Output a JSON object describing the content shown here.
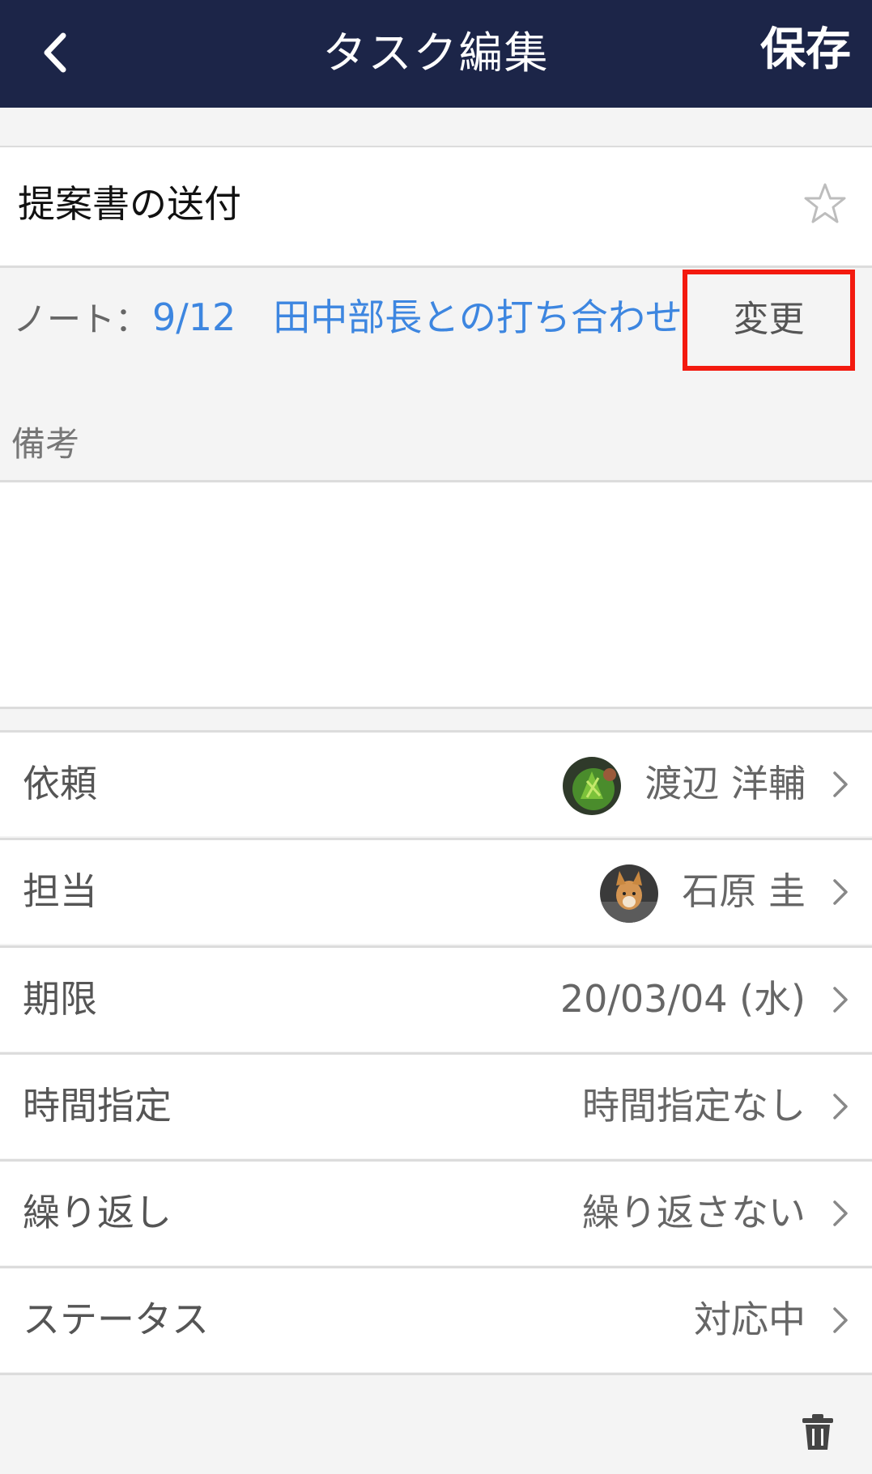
{
  "header": {
    "title": "タスク編集",
    "save_label": "保存"
  },
  "task": {
    "title": "提案書の送付"
  },
  "note": {
    "label": "ノート：",
    "link_text": "9/12　田中部長との打ち合わせ",
    "change_label": "変更"
  },
  "remarks": {
    "label": "備考",
    "value": ""
  },
  "rows": [
    {
      "label": "依頼",
      "value": "渡辺 洋輔",
      "avatar": "avatar-plant"
    },
    {
      "label": "担当",
      "value": "石原 圭",
      "avatar": "avatar-dog"
    },
    {
      "label": "期限",
      "value": "20/03/04 (水)"
    },
    {
      "label": "時間指定",
      "value": "時間指定なし"
    },
    {
      "label": "繰り返し",
      "value": "繰り返さない"
    },
    {
      "label": "ステータス",
      "value": "対応中"
    }
  ],
  "colors": {
    "header_bg": "#1c2548",
    "link": "#3d86e0",
    "highlight_border": "#f31a0f"
  }
}
